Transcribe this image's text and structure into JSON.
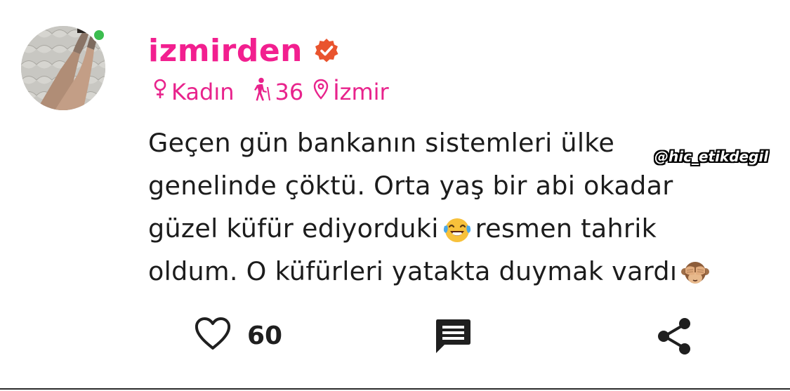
{
  "post": {
    "username": "izmirden",
    "verified": true,
    "online": true,
    "meta": {
      "gender": "Kadın",
      "age": "36",
      "city": "İzmir"
    },
    "text_lines": [
      "Geçen gün bankanın sistemleri ülke",
      "genelinde çöktü. Orta yaş bir abi okadar",
      "güzel küfür ediyorduki",
      "resmen tahrik",
      "oldum. O küfürleri yatakta duymak vardı"
    ],
    "watermark": "@hic_etikdegil",
    "actions": {
      "like_count": "60"
    }
  },
  "icons": {
    "gender": "female-symbol-icon",
    "age": "walking-person-icon",
    "location": "location-pin-icon",
    "verified": "verified-badge-icon",
    "like": "heart-outline-icon",
    "comment": "comment-bubble-icon",
    "share": "share-icon",
    "emoji_1": "laughing-tears-emoji-icon",
    "emoji_2": "see-no-evil-monkey-emoji-icon"
  },
  "colors": {
    "accent_pink": "#f21f8f",
    "online_green": "#3cbd4f",
    "text": "#1c1c1c"
  }
}
